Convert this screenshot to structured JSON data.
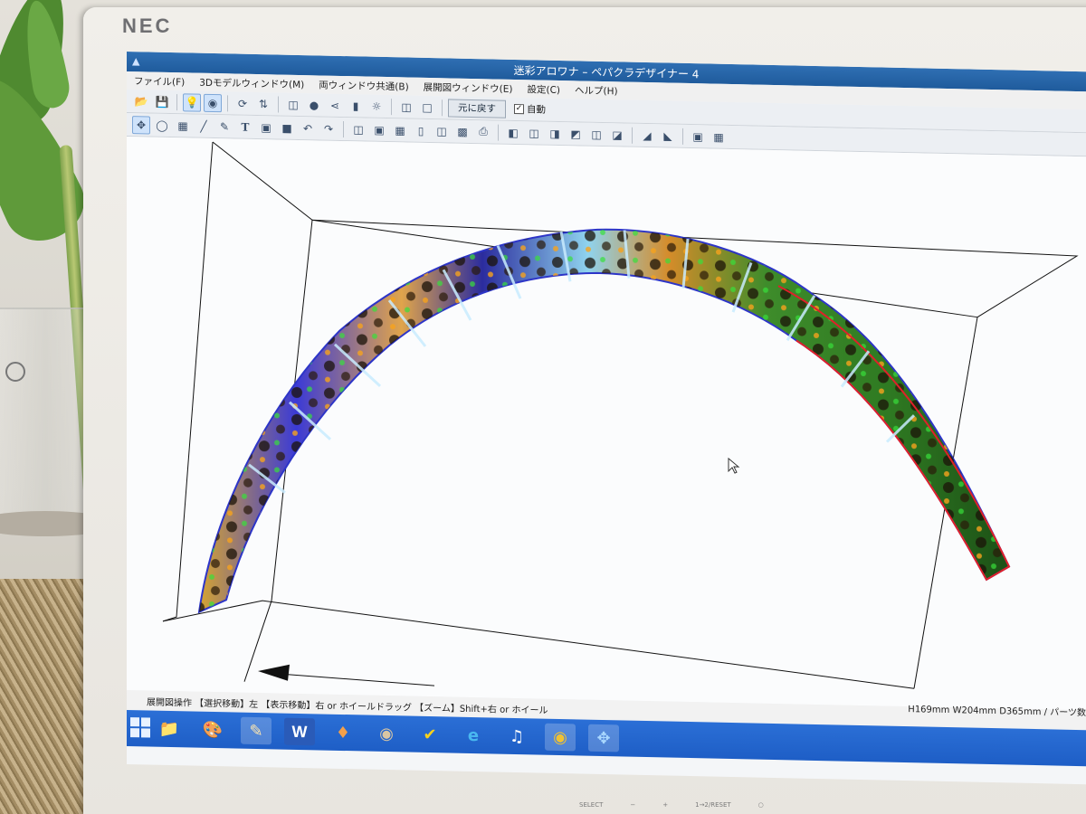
{
  "monitor": {
    "brand": "NEC",
    "bezel_buttons": [
      "SELECT",
      "−",
      "+",
      "1→2/RESET",
      "○"
    ]
  },
  "window": {
    "title": "迷彩アロワナ – ペパクラデザイナー 4",
    "menu": [
      "ファイル(F)",
      "3Dモデルウィンドウ(M)",
      "両ウィンドウ共通(B)",
      "展開図ウィンドウ(E)",
      "設定(C)",
      "ヘルプ(H)"
    ],
    "toolbar1": {
      "buttons_left": [
        "folder-open-icon",
        "save-icon",
        "lightbulb-icon",
        "model-view-icon",
        "rotate-part-icon",
        "flip-icon",
        "fold-icon",
        "glue-icon",
        "axes-icon",
        "split-icon",
        "texture-icon",
        "single-view-icon",
        "dual-view-icon"
      ],
      "undo_label": "元に戻す",
      "auto_label": "自動",
      "auto_checked": "✓"
    },
    "toolbar2": {
      "buttons": [
        "select-move-icon",
        "rotate-icon",
        "join-edges-icon",
        "line-tool-icon",
        "paint-icon",
        "text-tool-icon",
        "image-icon",
        "part-icon",
        "undo-arrow-icon",
        "redo-arrow-icon",
        "book-icon",
        "fit-page-icon",
        "layout-icon",
        "page-icon",
        "page-add-icon",
        "page-print-preview-icon",
        "printer-icon",
        "align-left-icon",
        "align-center-icon",
        "align-right-icon",
        "align-top-icon",
        "align-middle-icon",
        "align-bottom-icon",
        "distribute-icon",
        "mirror-icon",
        "fit-frame-icon",
        "expand-frame-icon"
      ]
    },
    "status": {
      "left": "展開図操作 【選択移動】左 【表示移動】右 or ホイールドラッグ 【ズーム】Shift+右 or ホイール",
      "right": "H169mm W204mm D365mm / パーツ数"
    },
    "taskbar": [
      "file-explorer-icon",
      "paint-app-icon",
      "paper-craft-app-icon",
      "word-icon",
      "game-icon",
      "gimp-icon",
      "norton-icon",
      "internet-explorer-icon",
      "itunes-icon",
      "chrome-icon",
      "pepakura-icon"
    ]
  },
  "colors": {
    "title_bar": "#1f5b9c",
    "taskbar": "#1e5ec6",
    "accent_selected": "#cfe3fb",
    "part_outline_red": "#e0202a"
  }
}
